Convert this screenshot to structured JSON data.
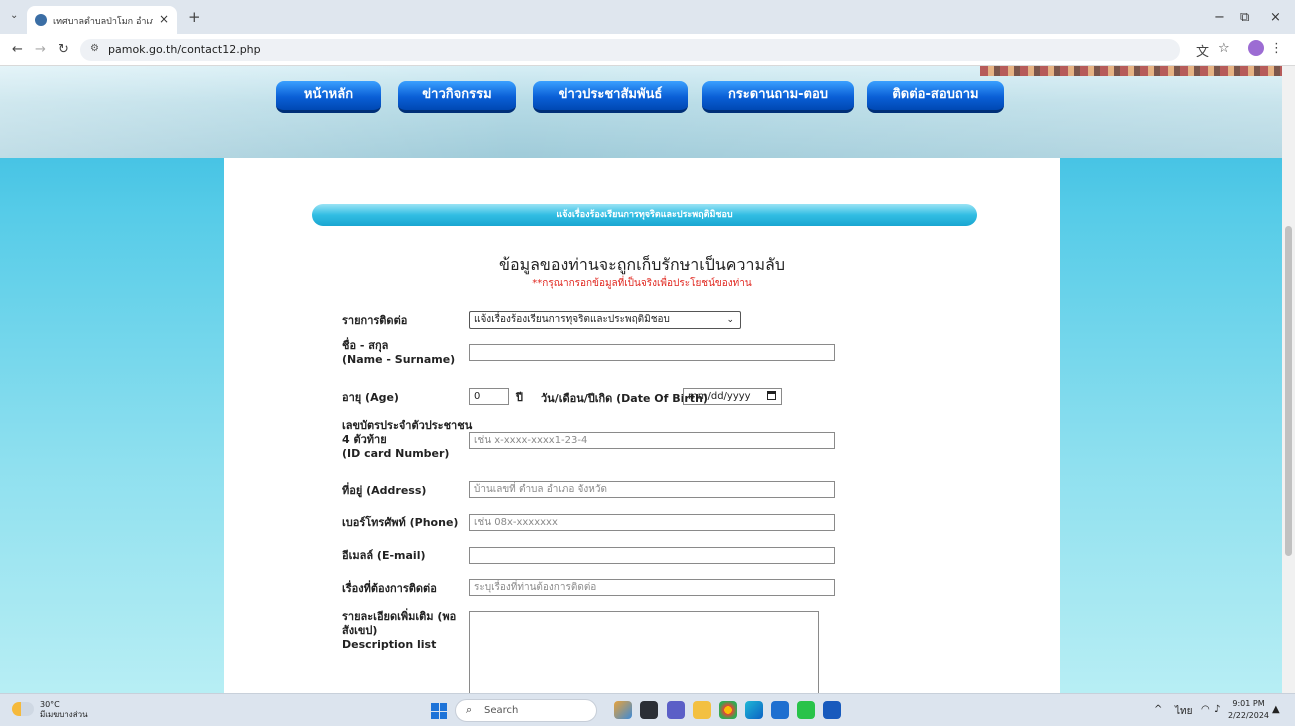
{
  "browser": {
    "tab_title": "เทศบาลตำบลป่าโมก อำเภอป่าโมก จั",
    "new_tab": "+",
    "tab_close": "×",
    "url": "pamok.go.th/contact12.php",
    "window_min": "−",
    "window_restore": "⧉",
    "window_close": "×"
  },
  "menu": {
    "items": [
      {
        "label": "หน้าหลัก"
      },
      {
        "label": "ข่าวกิจกรรม"
      },
      {
        "label": "ข่าวประชาสัมพันธ์"
      },
      {
        "label": "กระดานถาม-ตอบ"
      },
      {
        "label": "ติดต่อ-สอบถาม"
      }
    ]
  },
  "form": {
    "section_title": "แจ้งเรื่องร้องเรียนการทุจริตและประพฤติมิชอบ",
    "headline": "ข้อมูลของท่านจะถูกเก็บรักษาเป็นความลับ",
    "note": "**กรุณากรอกข้อมูลที่เป็นจริงเพื่อประโยชน์ของท่าน",
    "contact_type_label": "รายการติดต่อ",
    "contact_type_value": "แจ้งเรื่องร้องเรียนการทุจริตและประพฤติมิชอบ",
    "name_label": "ชื่อ - สกุล",
    "name_label_en": "(Name - Surname)",
    "name_value": "",
    "age_label": "อายุ (Age)",
    "age_value": "0",
    "age_unit": "ปี",
    "dob_label": "วัน/เดือน/ปีเกิด (Date Of Birth)",
    "dob_placeholder": "mm/dd/yyyy",
    "id_label_1": "เลขบัตรประจำตัวประชาชน",
    "id_label_2": "4 ตัวท้าย",
    "id_label_3": "(ID card Number)",
    "id_placeholder": "เช่น x-xxxx-xxxx1-23-4",
    "address_label": "ที่อยู่ (Address)",
    "address_placeholder": "บ้านเลขที่ ตำบล อำเภอ จังหวัด",
    "phone_label": "เบอร์โทรศัพท์ (Phone)",
    "phone_placeholder": "เช่น 08x-xxxxxxx",
    "email_label": "อีเมลล์ (E-mail)",
    "email_value": "",
    "subject_label": "เรื่องที่ต้องการติดต่อ",
    "subject_placeholder": "ระบุเรื่องที่ท่านต้องการติดต่อ",
    "details_label_1": "รายละเอียดเพิ่มเติม (พอ",
    "details_label_2": "สังเขป)",
    "details_label_3": "Description list"
  },
  "taskbar": {
    "temperature": "30°C",
    "weather_text": "มีเมฆบางส่วน",
    "search_label": "Search",
    "lang": "ไทย",
    "time": "9:01 PM",
    "date": "2/22/2024"
  },
  "colors": {
    "menu_blue": "#0a5fd6",
    "section_bar": "#31bde3",
    "note_red": "#e0261e",
    "page_bg": "#57cce8"
  }
}
